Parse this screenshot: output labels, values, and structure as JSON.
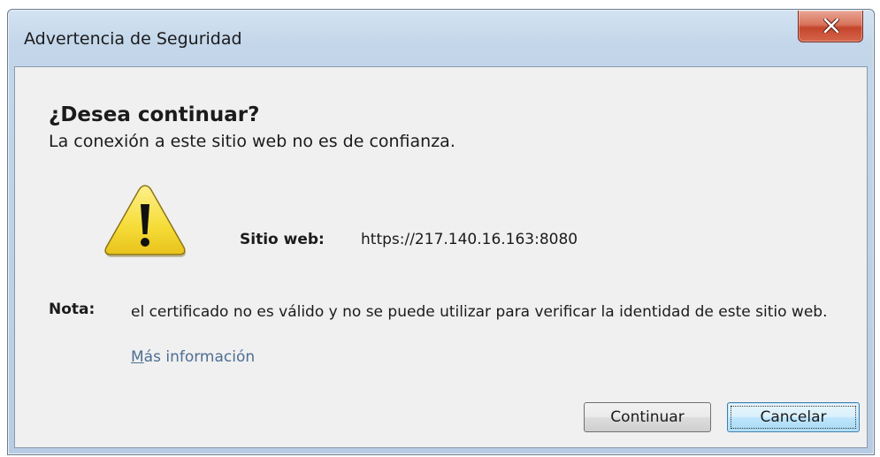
{
  "window": {
    "title": "Advertencia de Seguridad",
    "close_glyph": "X"
  },
  "dialog": {
    "heading": "¿Desea continuar?",
    "subheading": "La conexión a este sitio web no es de confianza.",
    "icon": "warning-triangle-icon",
    "site_label": "Sitio web:",
    "site_value": "https://217.140.16.163:8080",
    "note_label": "Nota:",
    "note_text": "el certificado no es válido y no se puede utilizar para verificar la identidad de este sitio web.",
    "more_info_access_key": "M",
    "more_info_rest": "ás información"
  },
  "buttons": {
    "continue_label": "Continuar",
    "cancel_label": "Cancelar"
  },
  "colors": {
    "link": "#4d6e92",
    "warning_fill": "#f7e04a",
    "close_button": "#c4452c"
  }
}
